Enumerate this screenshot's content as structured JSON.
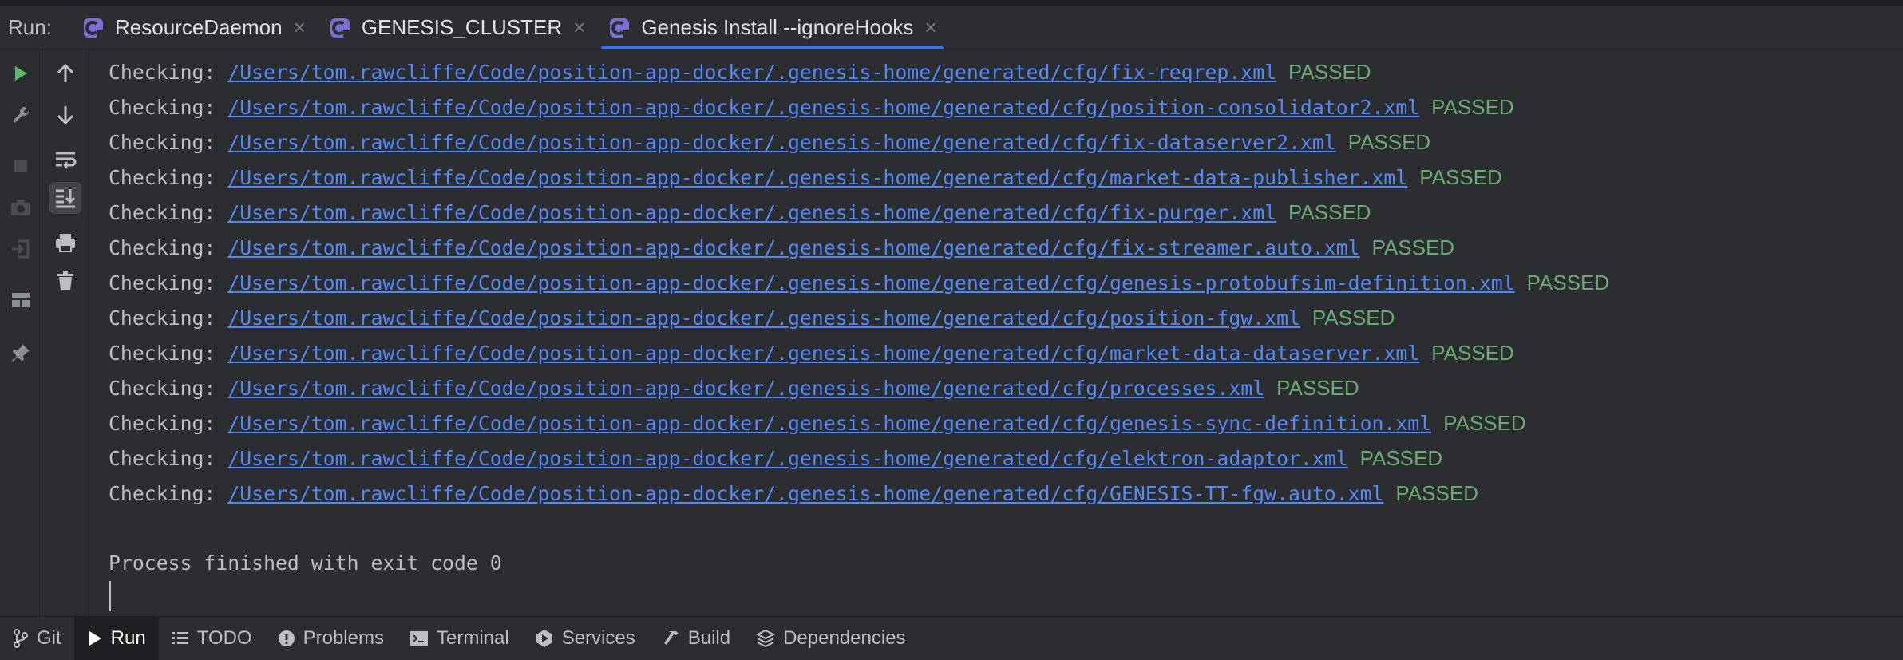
{
  "run_label": "Run:",
  "tabs": [
    {
      "label": "ResourceDaemon"
    },
    {
      "label": "GENESIS_CLUSTER"
    },
    {
      "label": "Genesis Install --ignoreHooks"
    }
  ],
  "console": {
    "lines": [
      {
        "label": "Checking:",
        "path": "/Users/tom.rawcliffe/Code/position-app-docker/.genesis-home/generated/cfg/fix-reqrep.xml",
        "status": "PASSED"
      },
      {
        "label": "Checking:",
        "path": "/Users/tom.rawcliffe/Code/position-app-docker/.genesis-home/generated/cfg/position-consolidator2.xml",
        "status": "PASSED"
      },
      {
        "label": "Checking:",
        "path": "/Users/tom.rawcliffe/Code/position-app-docker/.genesis-home/generated/cfg/fix-dataserver2.xml",
        "status": "PASSED"
      },
      {
        "label": "Checking:",
        "path": "/Users/tom.rawcliffe/Code/position-app-docker/.genesis-home/generated/cfg/market-data-publisher.xml",
        "status": "PASSED"
      },
      {
        "label": "Checking:",
        "path": "/Users/tom.rawcliffe/Code/position-app-docker/.genesis-home/generated/cfg/fix-purger.xml",
        "status": "PASSED"
      },
      {
        "label": "Checking:",
        "path": "/Users/tom.rawcliffe/Code/position-app-docker/.genesis-home/generated/cfg/fix-streamer.auto.xml",
        "status": "PASSED"
      },
      {
        "label": "Checking:",
        "path": "/Users/tom.rawcliffe/Code/position-app-docker/.genesis-home/generated/cfg/genesis-protobufsim-definition.xml",
        "status": "PASSED"
      },
      {
        "label": "Checking:",
        "path": "/Users/tom.rawcliffe/Code/position-app-docker/.genesis-home/generated/cfg/position-fgw.xml",
        "status": "PASSED"
      },
      {
        "label": "Checking:",
        "path": "/Users/tom.rawcliffe/Code/position-app-docker/.genesis-home/generated/cfg/market-data-dataserver.xml",
        "status": "PASSED"
      },
      {
        "label": "Checking:",
        "path": "/Users/tom.rawcliffe/Code/position-app-docker/.genesis-home/generated/cfg/processes.xml",
        "status": "PASSED"
      },
      {
        "label": "Checking:",
        "path": "/Users/tom.rawcliffe/Code/position-app-docker/.genesis-home/generated/cfg/genesis-sync-definition.xml",
        "status": "PASSED"
      },
      {
        "label": "Checking:",
        "path": "/Users/tom.rawcliffe/Code/position-app-docker/.genesis-home/generated/cfg/elektron-adaptor.xml",
        "status": "PASSED"
      },
      {
        "label": "Checking:",
        "path": "/Users/tom.rawcliffe/Code/position-app-docker/.genesis-home/generated/cfg/GENESIS-TT-fgw.auto.xml",
        "status": "PASSED"
      }
    ],
    "finished": "Process finished with exit code 0"
  },
  "left_toolbar": {
    "strip1_icons": [
      "run-icon",
      "wrench-icon",
      "stop-icon",
      "camera-icon",
      "login-icon",
      "layout-icon",
      "pin-icon"
    ],
    "strip2_icons": [
      "arrow-up-icon",
      "arrow-down-icon",
      "soft-wrap-icon",
      "scroll-to-end-icon",
      "print-icon",
      "trash-icon"
    ]
  },
  "bottom_bar": {
    "items": [
      {
        "label": "Git",
        "icon": "git-branch-icon"
      },
      {
        "label": "Run",
        "icon": "play-icon"
      },
      {
        "label": "TODO",
        "icon": "todo-list-icon"
      },
      {
        "label": "Problems",
        "icon": "problems-icon"
      },
      {
        "label": "Terminal",
        "icon": "terminal-icon"
      },
      {
        "label": "Services",
        "icon": "services-icon"
      },
      {
        "label": "Build",
        "icon": "hammer-icon"
      },
      {
        "label": "Dependencies",
        "icon": "dependencies-icon"
      }
    ],
    "active": "Run"
  },
  "colors": {
    "background": "#2b2d30",
    "link": "#548af7",
    "passed": "#6aab73",
    "accent": "#3574f0",
    "run_green": "#5fb865"
  }
}
